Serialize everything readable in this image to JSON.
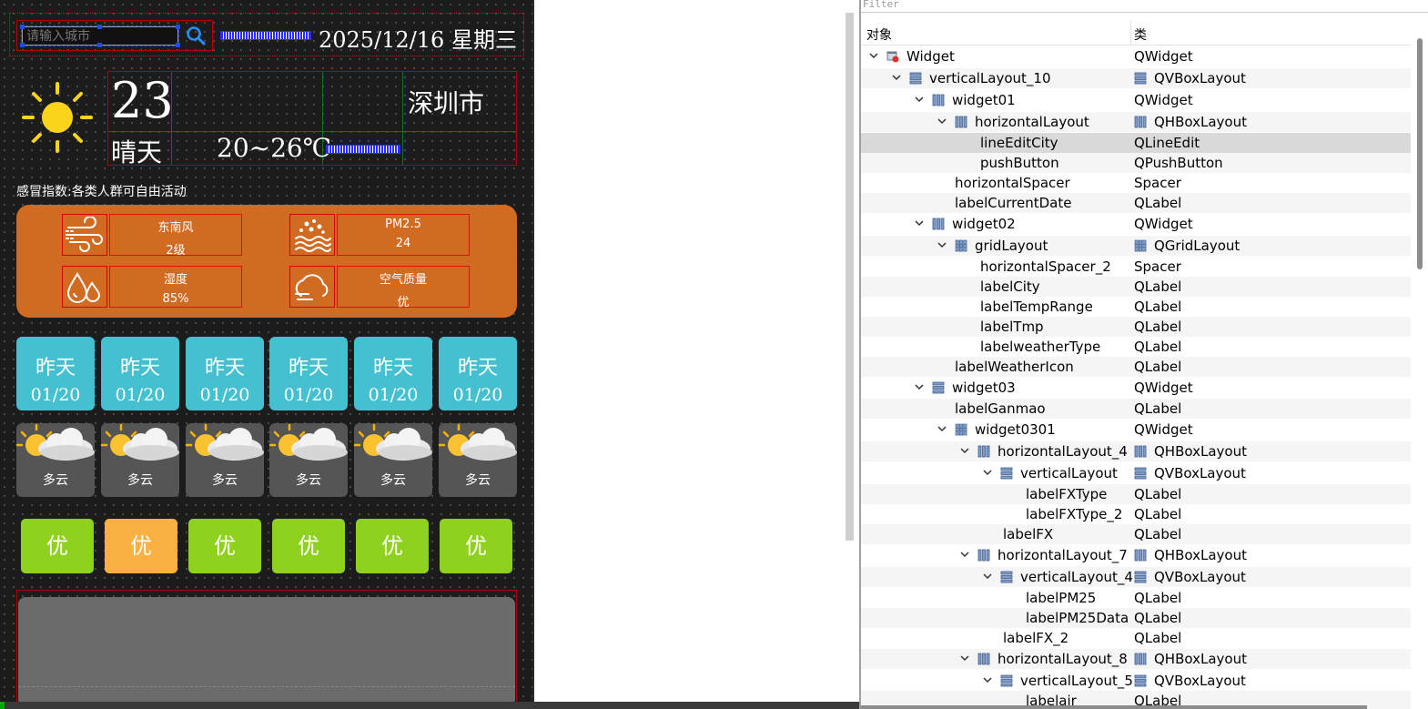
{
  "weather": {
    "search_placeholder": "请输入城市",
    "date": "2025/12/16  星期三",
    "temp": "23",
    "city": "深圳市",
    "weather_type": "晴天",
    "temp_range": "20~26℃",
    "ganmao": "感冒指数:各类人群可自由活动",
    "info": [
      {
        "icon": "wind-icon",
        "title": "东南风",
        "value": "2级"
      },
      {
        "icon": "pm25-icon",
        "title": "PM2.5",
        "value": "24"
      },
      {
        "icon": "humidity-icon",
        "title": "湿度",
        "value": "85%"
      },
      {
        "icon": "air-quality-icon",
        "title": "空气质量",
        "value": "优"
      }
    ],
    "days": [
      {
        "name": "昨天",
        "date": "01/20",
        "type": "多云",
        "aq": "优"
      },
      {
        "name": "昨天",
        "date": "01/20",
        "type": "多云",
        "aq": "优"
      },
      {
        "name": "昨天",
        "date": "01/20",
        "type": "多云",
        "aq": "优"
      },
      {
        "name": "昨天",
        "date": "01/20",
        "type": "多云",
        "aq": "优"
      },
      {
        "name": "昨天",
        "date": "01/20",
        "type": "多云",
        "aq": "优"
      },
      {
        "name": "昨天",
        "date": "01/20",
        "type": "多云",
        "aq": "优"
      }
    ],
    "colors": {
      "info_panel": "#d26b22",
      "day_card": "#45c0d0",
      "aq_good": "#8fd11f",
      "aq_highlight": "#fbb042"
    }
  },
  "inspector": {
    "filter_placeholder": "Filter",
    "header_object": "对象",
    "header_class": "类",
    "rows": [
      {
        "name": "Widget",
        "cls": "QWidget",
        "depth": 0,
        "expanded": true,
        "icon": "form-icon",
        "cls_icon": ""
      },
      {
        "name": "verticalLayout_10",
        "cls": "QVBoxLayout",
        "depth": 1,
        "expanded": true,
        "icon": "vbox-icon",
        "cls_icon": "vbox-icon"
      },
      {
        "name": "widget01",
        "cls": "QWidget",
        "depth": 2,
        "expanded": true,
        "icon": "hbox-icon",
        "cls_icon": ""
      },
      {
        "name": "horizontalLayout",
        "cls": "QHBoxLayout",
        "depth": 3,
        "expanded": true,
        "icon": "hbox-icon",
        "cls_icon": "hbox-icon"
      },
      {
        "name": "lineEditCity",
        "cls": "QLineEdit",
        "depth": 4,
        "expanded": null,
        "icon": "",
        "cls_icon": "",
        "selected": true
      },
      {
        "name": "pushButton",
        "cls": "QPushButton",
        "depth": 4,
        "expanded": null,
        "icon": "",
        "cls_icon": ""
      },
      {
        "name": "horizontalSpacer",
        "cls": "Spacer",
        "depth": 3,
        "expanded": null,
        "icon": "",
        "cls_icon": ""
      },
      {
        "name": "labelCurrentDate",
        "cls": "QLabel",
        "depth": 3,
        "expanded": null,
        "icon": "",
        "cls_icon": ""
      },
      {
        "name": "widget02",
        "cls": "QWidget",
        "depth": 2,
        "expanded": true,
        "icon": "hbox-icon",
        "cls_icon": ""
      },
      {
        "name": "gridLayout",
        "cls": "QGridLayout",
        "depth": 3,
        "expanded": true,
        "icon": "grid-icon",
        "cls_icon": "grid-icon"
      },
      {
        "name": "horizontalSpacer_2",
        "cls": "Spacer",
        "depth": 4,
        "expanded": null,
        "icon": "",
        "cls_icon": ""
      },
      {
        "name": "labelCity",
        "cls": "QLabel",
        "depth": 4,
        "expanded": null,
        "icon": "",
        "cls_icon": ""
      },
      {
        "name": "labelTempRange",
        "cls": "QLabel",
        "depth": 4,
        "expanded": null,
        "icon": "",
        "cls_icon": ""
      },
      {
        "name": "labelTmp",
        "cls": "QLabel",
        "depth": 4,
        "expanded": null,
        "icon": "",
        "cls_icon": ""
      },
      {
        "name": "labelweatherType",
        "cls": "QLabel",
        "depth": 4,
        "expanded": null,
        "icon": "",
        "cls_icon": ""
      },
      {
        "name": "labelWeatherIcon",
        "cls": "QLabel",
        "depth": 3,
        "expanded": null,
        "icon": "",
        "cls_icon": ""
      },
      {
        "name": "widget03",
        "cls": "QWidget",
        "depth": 2,
        "expanded": true,
        "icon": "vbox-icon",
        "cls_icon": ""
      },
      {
        "name": "labelGanmao",
        "cls": "QLabel",
        "depth": 3,
        "expanded": null,
        "icon": "",
        "cls_icon": ""
      },
      {
        "name": "widget0301",
        "cls": "QWidget",
        "depth": 3,
        "expanded": true,
        "icon": "grid-icon",
        "cls_icon": ""
      },
      {
        "name": "horizontalLayout_4",
        "cls": "QHBoxLayout",
        "depth": 4,
        "expanded": true,
        "icon": "hbox-icon",
        "cls_icon": "hbox-icon"
      },
      {
        "name": "verticalLayout",
        "cls": "QVBoxLayout",
        "depth": 5,
        "expanded": true,
        "icon": "vbox-icon",
        "cls_icon": "vbox-icon"
      },
      {
        "name": "labelFXType",
        "cls": "QLabel",
        "depth": 6,
        "expanded": null,
        "icon": "",
        "cls_icon": ""
      },
      {
        "name": "labelFXType_2",
        "cls": "QLabel",
        "depth": 6,
        "expanded": null,
        "icon": "",
        "cls_icon": ""
      },
      {
        "name": "labelFX",
        "cls": "QLabel",
        "depth": 5,
        "expanded": null,
        "icon": "",
        "cls_icon": ""
      },
      {
        "name": "horizontalLayout_7",
        "cls": "QHBoxLayout",
        "depth": 4,
        "expanded": true,
        "icon": "hbox-icon",
        "cls_icon": "hbox-icon"
      },
      {
        "name": "verticalLayout_4",
        "cls": "QVBoxLayout",
        "depth": 5,
        "expanded": true,
        "icon": "vbox-icon",
        "cls_icon": "vbox-icon"
      },
      {
        "name": "labelPM25",
        "cls": "QLabel",
        "depth": 6,
        "expanded": null,
        "icon": "",
        "cls_icon": ""
      },
      {
        "name": "labelPM25Data",
        "cls": "QLabel",
        "depth": 6,
        "expanded": null,
        "icon": "",
        "cls_icon": ""
      },
      {
        "name": "labelFX_2",
        "cls": "QLabel",
        "depth": 5,
        "expanded": null,
        "icon": "",
        "cls_icon": ""
      },
      {
        "name": "horizontalLayout_8",
        "cls": "QHBoxLayout",
        "depth": 4,
        "expanded": true,
        "icon": "hbox-icon",
        "cls_icon": "hbox-icon"
      },
      {
        "name": "verticalLayout_5",
        "cls": "QVBoxLayout",
        "depth": 5,
        "expanded": true,
        "icon": "vbox-icon",
        "cls_icon": "vbox-icon"
      },
      {
        "name": "labelair",
        "cls": "QLabel",
        "depth": 6,
        "expanded": null,
        "icon": "",
        "cls_icon": ""
      }
    ]
  }
}
